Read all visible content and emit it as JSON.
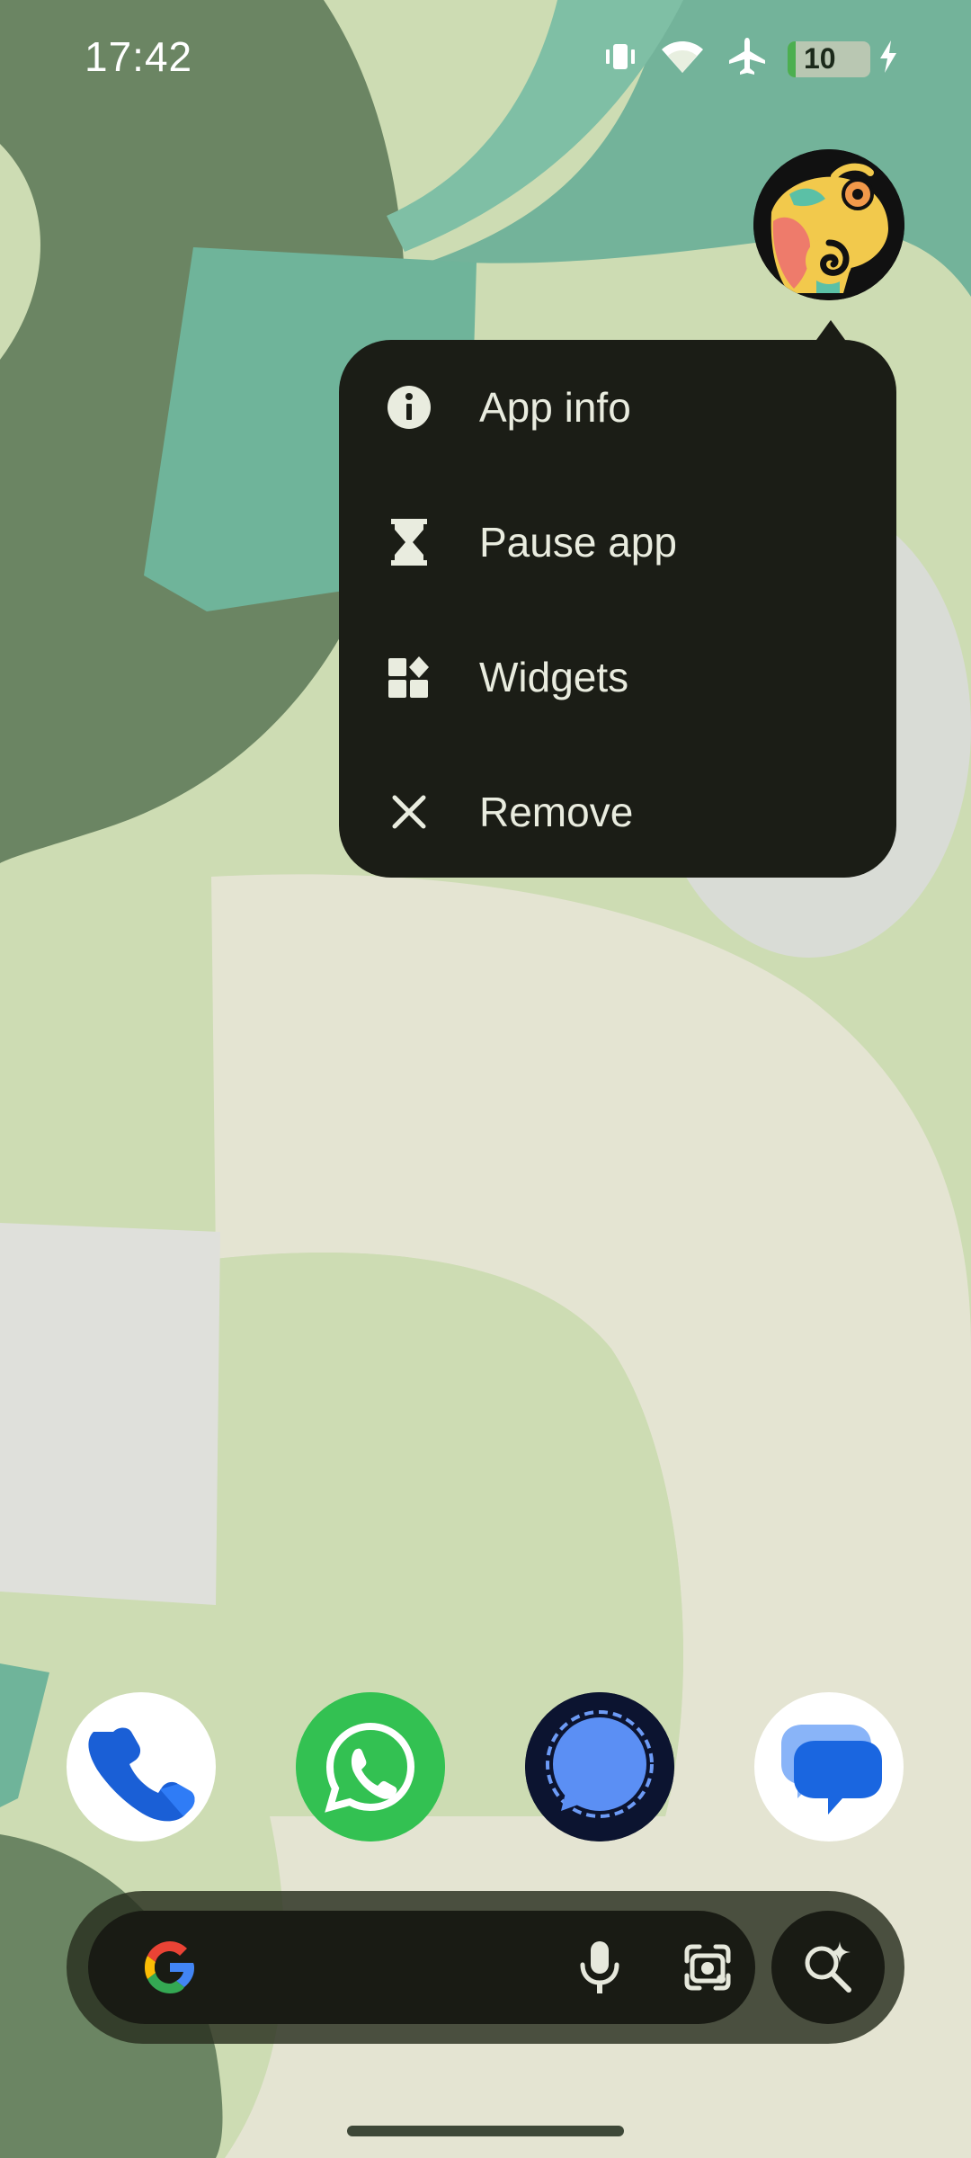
{
  "status_bar": {
    "time": "17:42",
    "icons": [
      "vibrate-icon",
      "wifi-icon",
      "airplane-mode-icon",
      "battery-charging-icon"
    ],
    "battery_level": "10",
    "battery_fraction": 0.1
  },
  "app_shortcut": {
    "icon": "chameleon-app-icon"
  },
  "popup_menu": {
    "items": [
      {
        "label": "App info",
        "icon": "info-icon"
      },
      {
        "label": "Pause app",
        "icon": "hourglass-icon"
      },
      {
        "label": "Widgets",
        "icon": "widgets-icon"
      },
      {
        "label": "Remove",
        "icon": "close-icon"
      }
    ]
  },
  "dock": {
    "apps": [
      {
        "icon": "phone-app-icon"
      },
      {
        "icon": "whatsapp-app-icon"
      },
      {
        "icon": "signal-app-icon"
      },
      {
        "icon": "messages-app-icon"
      }
    ]
  },
  "search_bar": {
    "icons": [
      "google-g-icon",
      "mic-icon",
      "lens-icon",
      "ai-search-icon"
    ]
  },
  "colors": {
    "wallpaper_base": "#cddcb3",
    "menu_background": "#1b1d16",
    "menu_text": "#e9ecdf",
    "search_pill": "#191b14"
  }
}
